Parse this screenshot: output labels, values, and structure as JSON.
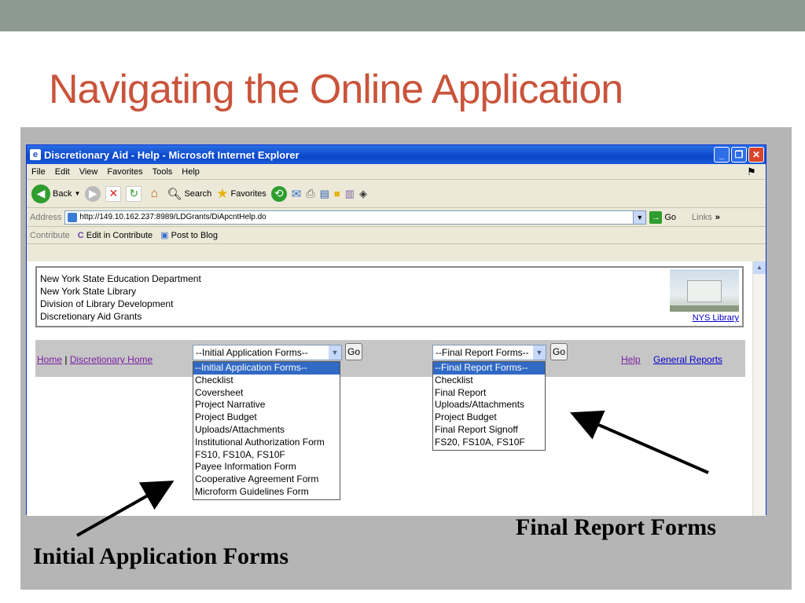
{
  "slide": {
    "title": "Navigating the Online Application"
  },
  "browser": {
    "window_title": "Discretionary Aid - Help - Microsoft Internet Explorer",
    "window_buttons": [
      "_",
      "❐",
      "✕"
    ],
    "menu": [
      "File",
      "Edit",
      "View",
      "Favorites",
      "Tools",
      "Help"
    ],
    "toolbar": {
      "back_label": "Back",
      "search_label": "Search",
      "favorites_label": "Favorites"
    },
    "address": {
      "label": "Address",
      "url": "http://149.10.162.237:8989/LDGrants/DiApcntHelp.do",
      "go_label": "Go",
      "links_label": "Links"
    },
    "contribute": {
      "label": "Contribute",
      "edit_label": "Edit in Contribute",
      "post_label": "Post to Blog"
    }
  },
  "page": {
    "org_lines": [
      "New York State Education Department",
      "New York State Library",
      "Division of Library Development",
      "Discretionary Aid Grants"
    ],
    "nys_link": "NYS Library",
    "nav": {
      "home": "Home",
      "separator": " | ",
      "discretionary_home": "Discretionary Home",
      "help": "Help",
      "general_reports": "General Reports"
    },
    "initial_select": {
      "selected": "--Initial Application Forms--",
      "go_label": "Go",
      "options": [
        "--Initial Application Forms--",
        "Checklist",
        "Coversheet",
        "Project Narrative",
        "Project Budget",
        "Uploads/Attachments",
        "Institutional Authorization Form",
        "FS10, FS10A, FS10F",
        "Payee Information Form",
        "Cooperative Agreement Form",
        "Microform Guidelines Form"
      ]
    },
    "final_select": {
      "selected": "--Final Report Forms--",
      "go_label": "Go",
      "options": [
        "--Final Report Forms--",
        "Checklist",
        "Final Report",
        "Uploads/Attachments",
        "Project Budget",
        "Final Report Signoff",
        "FS20, FS10A, FS10F"
      ]
    }
  },
  "captions": {
    "initial": "Initial Application Forms",
    "final": "Final Report Forms"
  },
  "colors": {
    "title": "#c9543b",
    "top_band": "#8d9a94",
    "selection": "#316ac5"
  }
}
